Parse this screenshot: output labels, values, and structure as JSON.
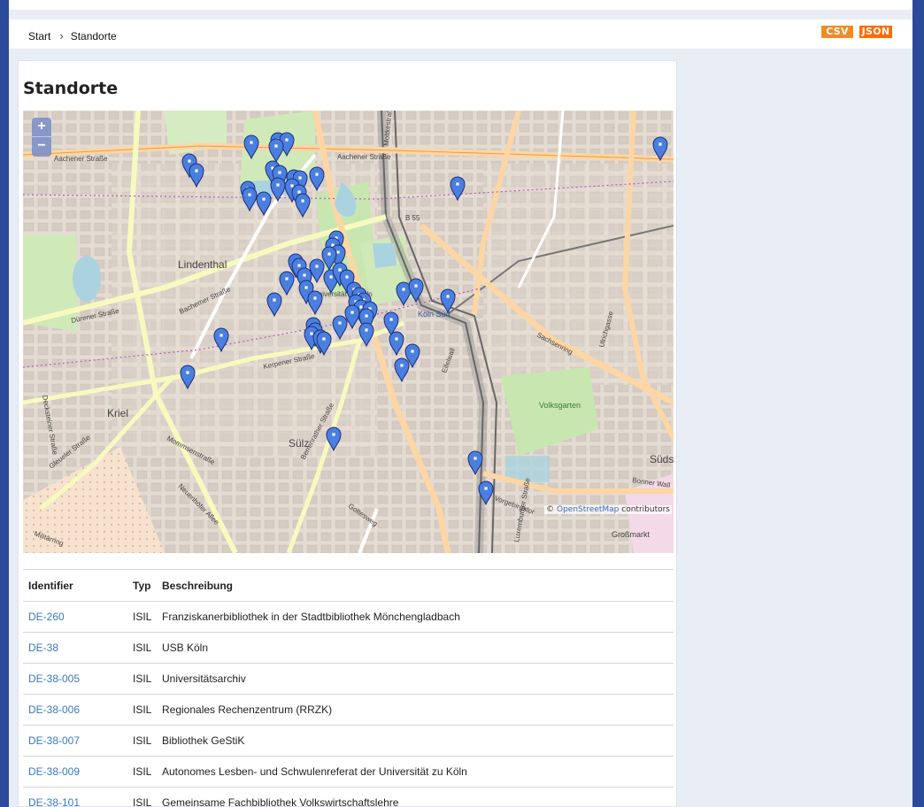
{
  "breadcrumb": {
    "home": "Start",
    "current": "Standorte"
  },
  "export": {
    "csv": "CSV",
    "json": "JSON"
  },
  "page_title": "Standorte",
  "map": {
    "zoom_in": "+",
    "zoom_out": "−",
    "attribution_prefix": "©",
    "attribution_link": "OpenStreetMap",
    "attribution_suffix": "contributors",
    "place_labels": [
      "Lindenthal",
      "Kriel",
      "Sülz",
      "Köln Süd",
      "Volksgarten",
      "Süds",
      "Großmarkt",
      "Aachener Straße",
      "Dürener Straße",
      "Bachemer Straße",
      "Kerpener Straße",
      "Gleueler Straße",
      "Sachsenring",
      "Ulrichgasse",
      "Eifelwall",
      "Moltkestraße",
      "Universität zu Köln",
      "B 55",
      "Bonner Wall",
      "Vorgebirgstor",
      "Gottesweg",
      "Militärring",
      "Decksteiner Straße",
      "Neuenhöfer Allee",
      "Mommsenstraße",
      "Berrenrather Straße",
      "Luxemburger Straße"
    ]
  },
  "table": {
    "headers": [
      "Identifier",
      "Typ",
      "Beschreibung"
    ],
    "rows": [
      [
        "DE-260",
        "ISIL",
        "Franziskanerbibliothek in der Stadtbibliothek Mönchengladbach"
      ],
      [
        "DE-38",
        "ISIL",
        "USB Köln"
      ],
      [
        "DE-38-005",
        "ISIL",
        "Universitätsarchiv"
      ],
      [
        "DE-38-006",
        "ISIL",
        "Regionales Rechenzentrum (RRZK)"
      ],
      [
        "DE-38-007",
        "ISIL",
        "Bibliothek GeStiK"
      ],
      [
        "DE-38-009",
        "ISIL",
        "Autonomes Lesben- und Schwulenreferat der Universität zu Köln"
      ],
      [
        "DE-38-101",
        "ISIL",
        "Gemeinsame Fachbibliothek Volkswirtschaftslehre"
      ]
    ]
  },
  "colors": {
    "accent": "#3a7ac0",
    "marker": "#4a7fe0",
    "csv": "#f08a24",
    "json": "#ff6a00"
  }
}
